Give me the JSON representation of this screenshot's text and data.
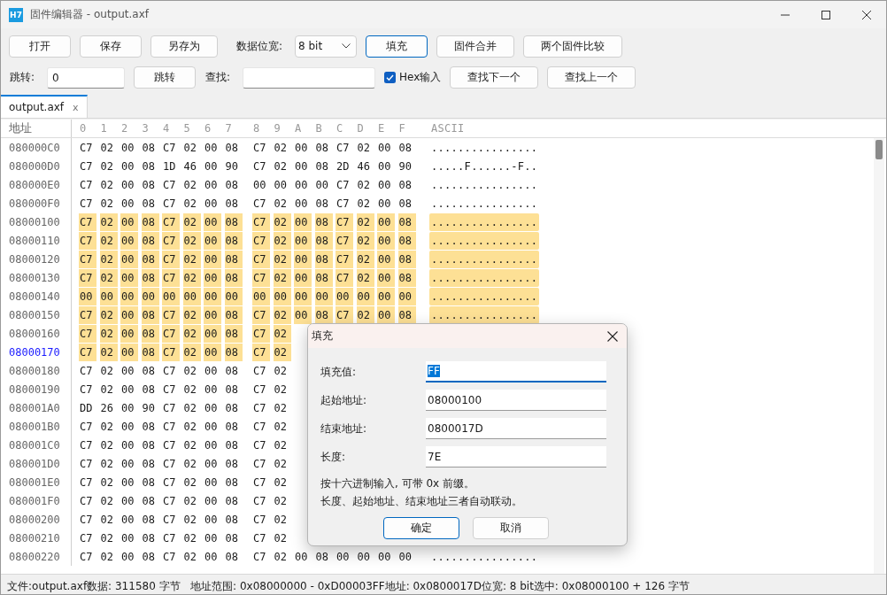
{
  "window": {
    "app_icon": "H7",
    "title": "固件编辑器 - output.axf"
  },
  "toolbar_row_1": [
    {
      "kind": "button",
      "label": "打开",
      "focused": false
    },
    {
      "kind": "button",
      "label": "保存",
      "focused": false
    },
    {
      "kind": "button",
      "label": "另存为",
      "focused": false
    },
    {
      "kind": "label",
      "label": "数据位宽:"
    },
    {
      "kind": "dropdown",
      "value": "8 bit"
    },
    {
      "kind": "button",
      "label": "填充",
      "focused": true
    },
    {
      "kind": "button",
      "label": "固件合并",
      "focused": false
    },
    {
      "kind": "button",
      "label": "两个固件比较",
      "focused": false
    }
  ],
  "toolbar_row_2": [
    {
      "kind": "label",
      "label": "跳转:"
    },
    {
      "kind": "input",
      "value": "0"
    },
    {
      "kind": "button",
      "label": "跳转",
      "focused": false
    },
    {
      "kind": "label",
      "label": "查找:"
    },
    {
      "kind": "input"
    },
    {
      "kind": "checkbox",
      "label": "Hex输入",
      "checked": true
    },
    {
      "kind": "button",
      "label": "查找下一个",
      "focused": false
    },
    {
      "kind": "button",
      "label": "查找上一个",
      "focused": false
    }
  ],
  "tabs": [
    {
      "label": "output.axf",
      "close": "x",
      "selected": true
    }
  ],
  "hex_view": {
    "address_heading": "地址",
    "byte_headings": [
      "0",
      "1",
      "2",
      "3",
      "4",
      "5",
      "6",
      "7",
      "8",
      "9",
      "A",
      "B",
      "C",
      "D",
      "E",
      "F"
    ],
    "ascii_heading": "ASCII",
    "rows": [
      {
        "address": "080000C0",
        "current": false,
        "selected": false,
        "bytes": [
          "C7",
          "02",
          "00",
          "08",
          "C7",
          "02",
          "00",
          "08",
          "C7",
          "02",
          "00",
          "08",
          "C7",
          "02",
          "00",
          "08"
        ],
        "ascii": "................"
      },
      {
        "address": "080000D0",
        "current": false,
        "selected": false,
        "bytes": [
          "C7",
          "02",
          "00",
          "08",
          "1D",
          "46",
          "00",
          "90",
          "C7",
          "02",
          "00",
          "08",
          "2D",
          "46",
          "00",
          "90"
        ],
        "ascii": ".....F......-F.."
      },
      {
        "address": "080000E0",
        "current": false,
        "selected": false,
        "bytes": [
          "C7",
          "02",
          "00",
          "08",
          "C7",
          "02",
          "00",
          "08",
          "00",
          "00",
          "00",
          "00",
          "C7",
          "02",
          "00",
          "08"
        ],
        "ascii": "................"
      },
      {
        "address": "080000F0",
        "current": false,
        "selected": false,
        "bytes": [
          "C7",
          "02",
          "00",
          "08",
          "C7",
          "02",
          "00",
          "08",
          "C7",
          "02",
          "00",
          "08",
          "C7",
          "02",
          "00",
          "08"
        ],
        "ascii": "................"
      },
      {
        "address": "08000100",
        "current": false,
        "selected": true,
        "bytes": [
          "C7",
          "02",
          "00",
          "08",
          "C7",
          "02",
          "00",
          "08",
          "C7",
          "02",
          "00",
          "08",
          "C7",
          "02",
          "00",
          "08"
        ],
        "ascii": "................"
      },
      {
        "address": "08000110",
        "current": false,
        "selected": true,
        "bytes": [
          "C7",
          "02",
          "00",
          "08",
          "C7",
          "02",
          "00",
          "08",
          "C7",
          "02",
          "00",
          "08",
          "C7",
          "02",
          "00",
          "08"
        ],
        "ascii": "................"
      },
      {
        "address": "08000120",
        "current": false,
        "selected": true,
        "bytes": [
          "C7",
          "02",
          "00",
          "08",
          "C7",
          "02",
          "00",
          "08",
          "C7",
          "02",
          "00",
          "08",
          "C7",
          "02",
          "00",
          "08"
        ],
        "ascii": "................"
      },
      {
        "address": "08000130",
        "current": false,
        "selected": true,
        "bytes": [
          "C7",
          "02",
          "00",
          "08",
          "C7",
          "02",
          "00",
          "08",
          "C7",
          "02",
          "00",
          "08",
          "C7",
          "02",
          "00",
          "08"
        ],
        "ascii": "................"
      },
      {
        "address": "08000140",
        "current": false,
        "selected": true,
        "bytes": [
          "00",
          "00",
          "00",
          "00",
          "00",
          "00",
          "00",
          "00",
          "00",
          "00",
          "00",
          "00",
          "00",
          "00",
          "00",
          "00"
        ],
        "ascii": "................"
      },
      {
        "address": "08000150",
        "current": false,
        "selected": true,
        "bytes": [
          "C7",
          "02",
          "00",
          "08",
          "C7",
          "02",
          "00",
          "08",
          "C7",
          "02",
          "00",
          "08",
          "C7",
          "02",
          "00",
          "08"
        ],
        "ascii": "................"
      },
      {
        "address": "08000160",
        "current": false,
        "selected": true,
        "bytes": [
          "C7",
          "02",
          "00",
          "08",
          "C7",
          "02",
          "00",
          "08",
          "C7",
          "02"
        ]
      },
      {
        "address": "08000170",
        "current": true,
        "selected": true,
        "bytes": [
          "C7",
          "02",
          "00",
          "08",
          "C7",
          "02",
          "00",
          "08",
          "C7",
          "02"
        ]
      },
      {
        "address": "08000180",
        "current": false,
        "selected": false,
        "bytes": [
          "C7",
          "02",
          "00",
          "08",
          "C7",
          "02",
          "00",
          "08",
          "C7",
          "02"
        ]
      },
      {
        "address": "08000190",
        "current": false,
        "selected": false,
        "bytes": [
          "C7",
          "02",
          "00",
          "08",
          "C7",
          "02",
          "00",
          "08",
          "C7",
          "02"
        ]
      },
      {
        "address": "080001A0",
        "current": false,
        "selected": false,
        "bytes": [
          "DD",
          "26",
          "00",
          "90",
          "C7",
          "02",
          "00",
          "08",
          "C7",
          "02"
        ]
      },
      {
        "address": "080001B0",
        "current": false,
        "selected": false,
        "bytes": [
          "C7",
          "02",
          "00",
          "08",
          "C7",
          "02",
          "00",
          "08",
          "C7",
          "02"
        ]
      },
      {
        "address": "080001C0",
        "current": false,
        "selected": false,
        "bytes": [
          "C7",
          "02",
          "00",
          "08",
          "C7",
          "02",
          "00",
          "08",
          "C7",
          "02"
        ]
      },
      {
        "address": "080001D0",
        "current": false,
        "selected": false,
        "bytes": [
          "C7",
          "02",
          "00",
          "08",
          "C7",
          "02",
          "00",
          "08",
          "C7",
          "02"
        ]
      },
      {
        "address": "080001E0",
        "current": false,
        "selected": false,
        "bytes": [
          "C7",
          "02",
          "00",
          "08",
          "C7",
          "02",
          "00",
          "08",
          "C7",
          "02"
        ]
      },
      {
        "address": "080001F0",
        "current": false,
        "selected": false,
        "bytes": [
          "C7",
          "02",
          "00",
          "08",
          "C7",
          "02",
          "00",
          "08",
          "C7",
          "02"
        ]
      },
      {
        "address": "08000200",
        "current": false,
        "selected": false,
        "bytes": [
          "C7",
          "02",
          "00",
          "08",
          "C7",
          "02",
          "00",
          "08",
          "C7",
          "02"
        ]
      },
      {
        "address": "08000210",
        "current": false,
        "selected": false,
        "bytes": [
          "C7",
          "02",
          "00",
          "08",
          "C7",
          "02",
          "00",
          "08",
          "C7",
          "02"
        ]
      },
      {
        "address": "08000220",
        "current": false,
        "selected": false,
        "bytes": [
          "C7",
          "02",
          "00",
          "08",
          "C7",
          "02",
          "00",
          "08",
          "C7",
          "02",
          "00",
          "08",
          "00",
          "00",
          "00",
          "00"
        ],
        "ascii": "................"
      }
    ]
  },
  "dialog": {
    "title": "填充",
    "fields": [
      {
        "label": "填充值:",
        "value": "FF",
        "focused": true,
        "text_selected": true
      },
      {
        "label": "起始地址:",
        "value": "08000100",
        "focused": false,
        "text_selected": false
      },
      {
        "label": "结束地址:",
        "value": "0800017D",
        "focused": false,
        "text_selected": false
      },
      {
        "label": "长度:",
        "value": "7E",
        "focused": false,
        "text_selected": false
      }
    ],
    "notes": [
      "按十六进制输入, 可带 0x 前缀。",
      "长度、起始地址、结束地址三者自动联动。"
    ],
    "buttons": [
      {
        "label": "确定",
        "default": true
      },
      {
        "label": "取消",
        "default": false
      }
    ]
  },
  "status_bar": "文件:output.axf数据: 311580 字节   地址范围: 0x08000000 - 0xD00003FF地址: 0x0800017D位宽: 8 bit选中: 0x08000100 + 126 字节"
}
